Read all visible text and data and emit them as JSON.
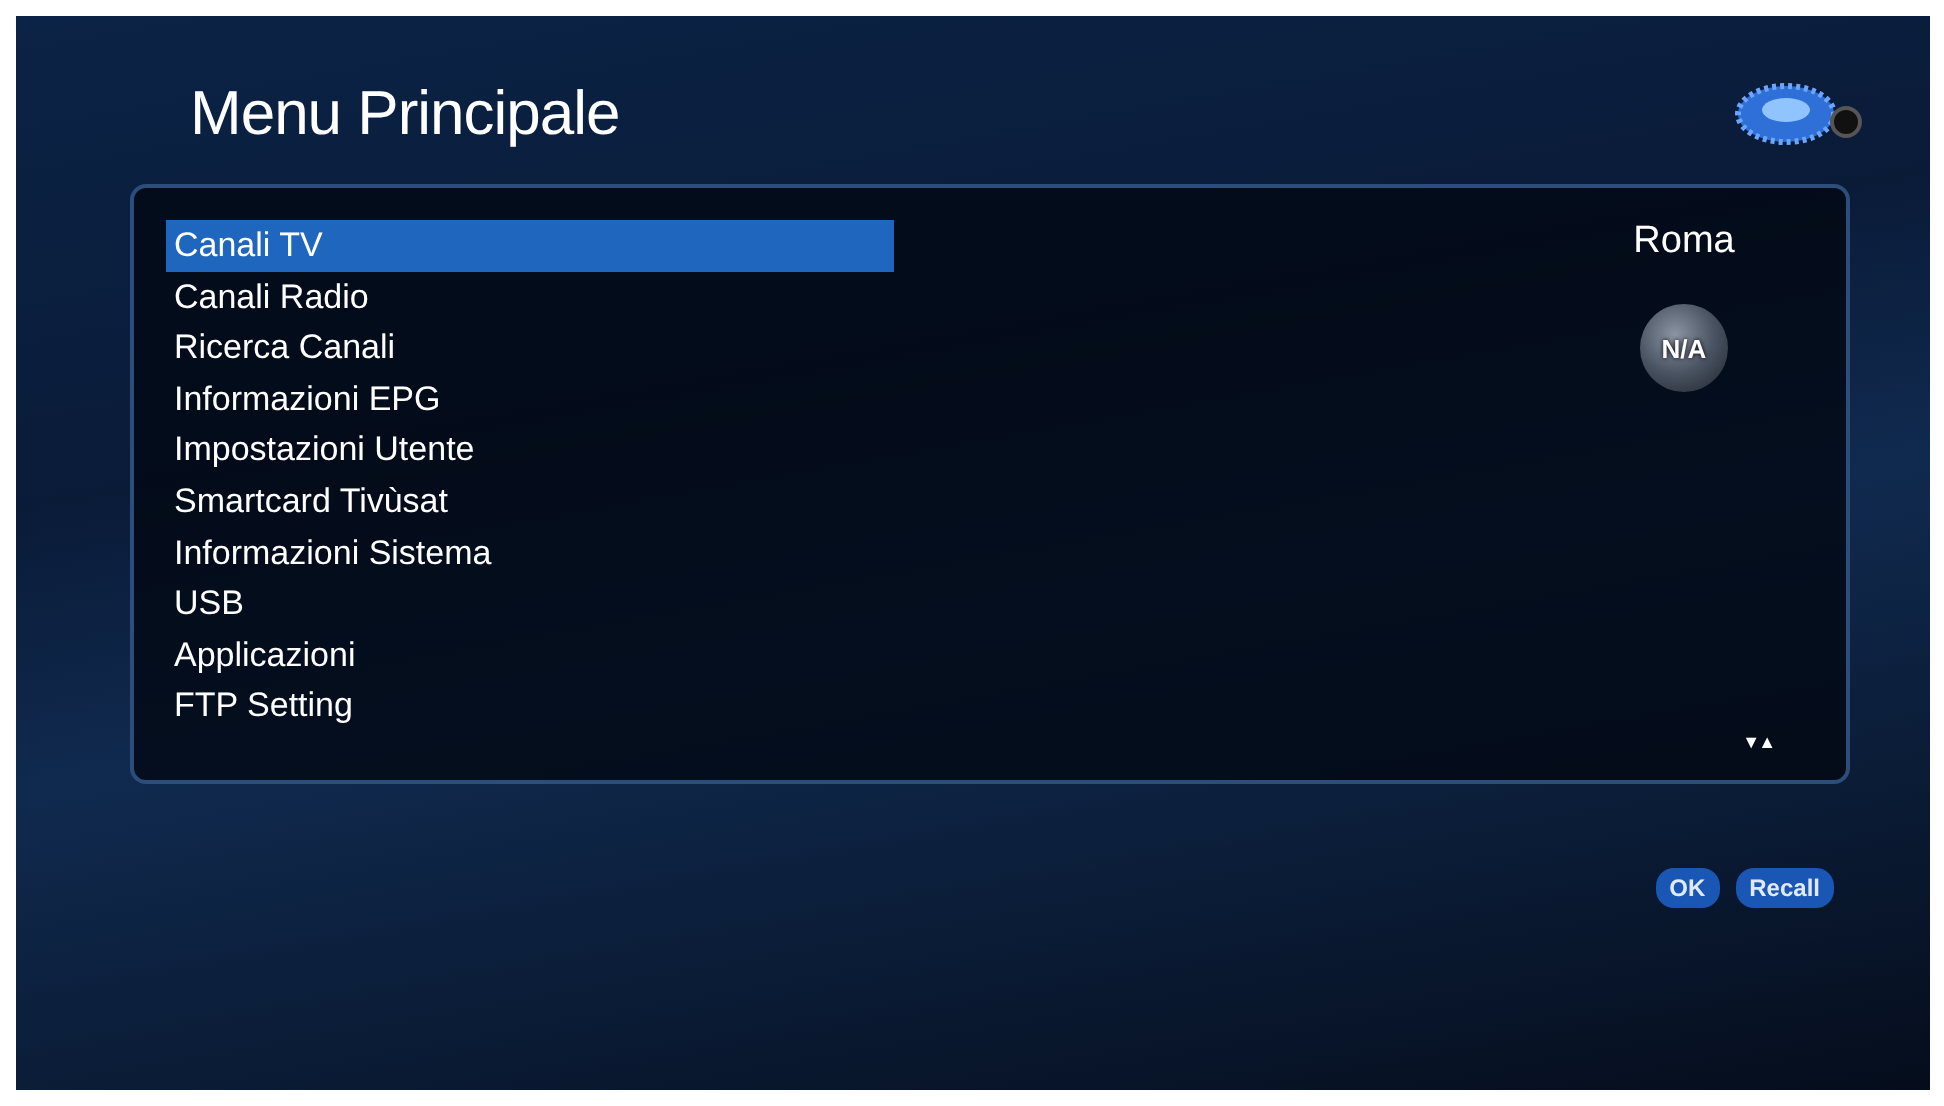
{
  "title": "Menu Principale",
  "menu": [
    {
      "label": "Canali TV",
      "selected": true
    },
    {
      "label": "Canali Radio",
      "selected": false
    },
    {
      "label": "Ricerca Canali",
      "selected": false
    },
    {
      "label": "Informazioni EPG",
      "selected": false
    },
    {
      "label": "Impostazioni Utente",
      "selected": false
    },
    {
      "label": "Smartcard Tivùsat",
      "selected": false
    },
    {
      "label": "Informazioni Sistema",
      "selected": false
    },
    {
      "label": "USB",
      "selected": false
    },
    {
      "label": "Applicazioni",
      "selected": false
    },
    {
      "label": "FTP Setting",
      "selected": false
    }
  ],
  "location": "Roma",
  "globe_label": "N/A",
  "scroll_arrows": "▼▲",
  "buttons": [
    "OK",
    "Recall"
  ]
}
